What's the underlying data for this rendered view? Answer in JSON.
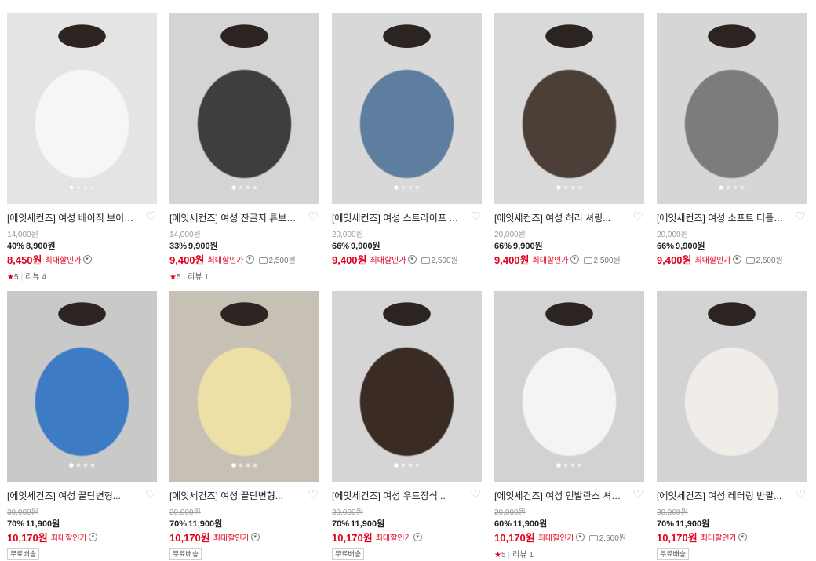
{
  "icons": {
    "wishlist": "heart-outline-icon",
    "expand": "chevron-down-icon",
    "coupon": "coupon-icon",
    "rating": "star-icon"
  },
  "colors": {
    "accent": "#e3001b",
    "strike": "#9a9a9a"
  },
  "products": [
    {
      "title": "[에잇세컨즈] 여성 베이직 브이넥...",
      "original_price": "14,000원",
      "discount_rate": "40%",
      "sale_price": "8,900원",
      "max_discount_price": "8,450원",
      "max_discount_label": "최대할인가",
      "coupon": "",
      "rating": "5",
      "review": "리뷰 4",
      "shipping": "",
      "dots": 4,
      "active_dot": 0
    },
    {
      "title": "[에잇세컨즈] 여성 잔골지 튜브탑...",
      "original_price": "14,000원",
      "discount_rate": "33%",
      "sale_price": "9,900원",
      "max_discount_price": "9,400원",
      "max_discount_label": "최대할인가",
      "coupon": "2,500원",
      "rating": "5",
      "review": "리뷰 1",
      "shipping": "",
      "dots": 4,
      "active_dot": 0
    },
    {
      "title": "[에잇세컨즈] 여성 스트라이프 립...",
      "original_price": "20,000원",
      "discount_rate": "66%",
      "sale_price": "9,900원",
      "max_discount_price": "9,400원",
      "max_discount_label": "최대할인가",
      "coupon": "2,500원",
      "rating": "",
      "review": "",
      "shipping": "",
      "dots": 4,
      "active_dot": 0
    },
    {
      "title": "[에잇세컨즈] 여성 허리 셔링...",
      "original_price": "20,000원",
      "discount_rate": "66%",
      "sale_price": "9,900원",
      "max_discount_price": "9,400원",
      "max_discount_label": "최대할인가",
      "coupon": "2,500원",
      "rating": "",
      "review": "",
      "shipping": "",
      "dots": 4,
      "active_dot": 0
    },
    {
      "title": "[에잇세컨즈] 여성 소프트 터틀넥...",
      "original_price": "20,000원",
      "discount_rate": "66%",
      "sale_price": "9,900원",
      "max_discount_price": "9,400원",
      "max_discount_label": "최대할인가",
      "coupon": "2,500원",
      "rating": "",
      "review": "",
      "shipping": "",
      "dots": 4,
      "active_dot": 0
    },
    {
      "title": "[에잇세컨즈] 여성 끝단변형...",
      "original_price": "30,000원",
      "discount_rate": "70%",
      "sale_price": "11,900원",
      "max_discount_price": "10,170원",
      "max_discount_label": "최대할인가",
      "coupon": "",
      "rating": "",
      "review": "",
      "shipping": "무료배송",
      "dots": 4,
      "active_dot": 0
    },
    {
      "title": "[에잇세컨즈] 여성 끝단변형...",
      "original_price": "30,000원",
      "discount_rate": "70%",
      "sale_price": "11,900원",
      "max_discount_price": "10,170원",
      "max_discount_label": "최대할인가",
      "coupon": "",
      "rating": "",
      "review": "",
      "shipping": "무료배송",
      "dots": 4,
      "active_dot": 0
    },
    {
      "title": "[에잇세컨즈] 여성 우드장식...",
      "original_price": "30,000원",
      "discount_rate": "70%",
      "sale_price": "11,900원",
      "max_discount_price": "10,170원",
      "max_discount_label": "최대할인가",
      "coupon": "",
      "rating": "",
      "review": "",
      "shipping": "무료배송",
      "dots": 4,
      "active_dot": 0
    },
    {
      "title": "[에잇세컨즈] 여성 언발란스 셔링...",
      "original_price": "20,000원",
      "discount_rate": "60%",
      "sale_price": "11,900원",
      "max_discount_price": "10,170원",
      "max_discount_label": "최대할인가",
      "coupon": "2,500원",
      "rating": "5",
      "review": "리뷰 1",
      "shipping": "",
      "dots": 4,
      "active_dot": 0
    },
    {
      "title": "[에잇세컨즈] 여성 레터링 반팔...",
      "original_price": "30,000원",
      "discount_rate": "70%",
      "sale_price": "11,900원",
      "max_discount_price": "10,170원",
      "max_discount_label": "최대할인가",
      "coupon": "",
      "rating": "",
      "review": "",
      "shipping": "무료배송",
      "dots": 0,
      "active_dot": 0
    }
  ]
}
